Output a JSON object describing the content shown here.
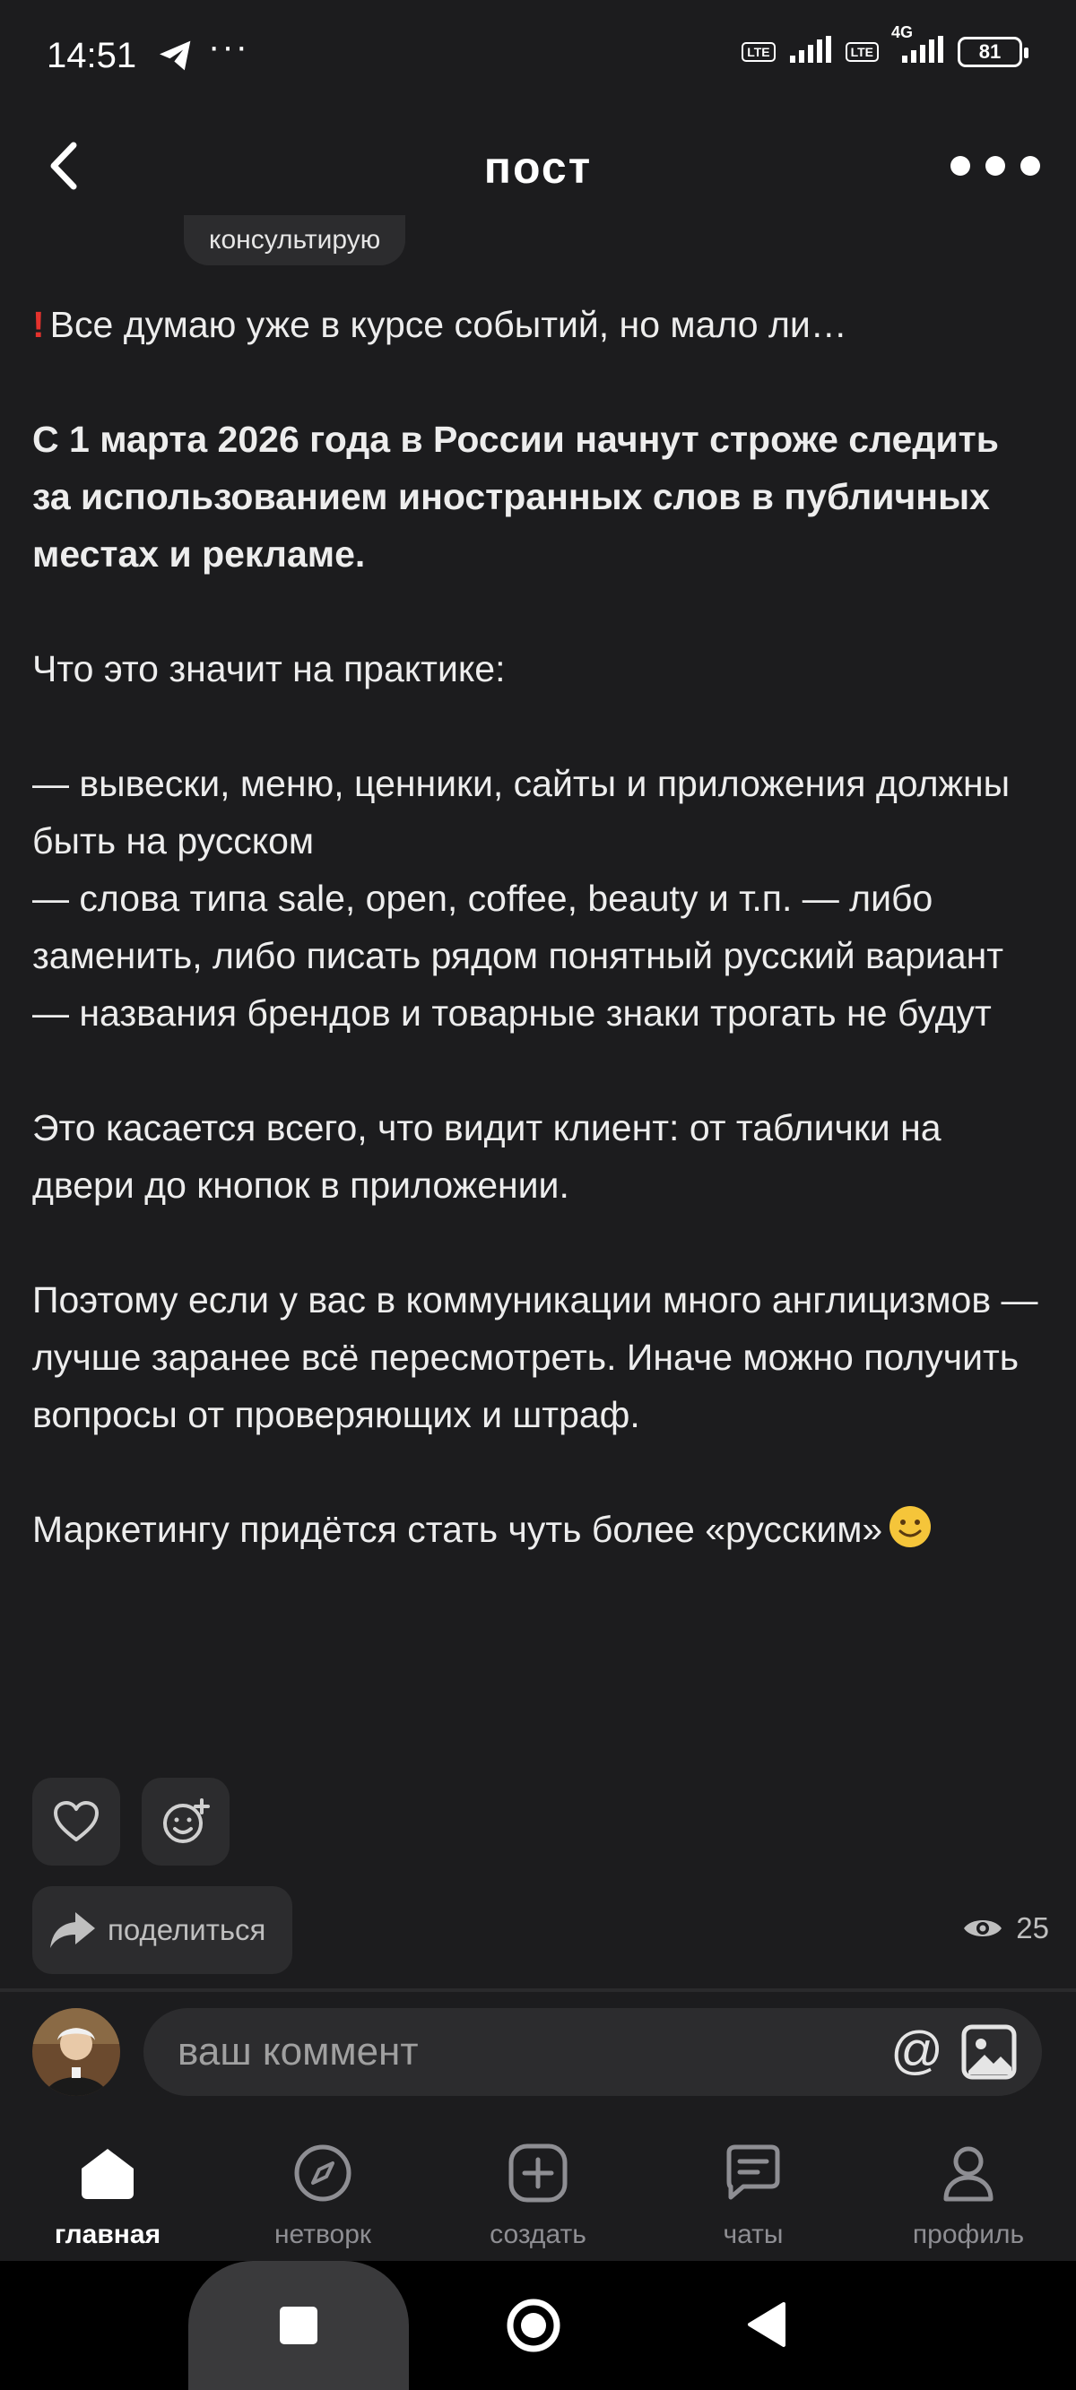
{
  "status_bar": {
    "time": "14:51",
    "more": "···",
    "volte1": "Vo LTE",
    "volte2": "Vo LTE",
    "network": "4G",
    "battery": "81"
  },
  "header": {
    "title": "пост"
  },
  "tag": {
    "label": "консультирую"
  },
  "post": {
    "intro": "Все думаю уже в курсе событий, но мало ли…",
    "headline": "С 1 марта 2026 года в России начнут строже следить за использованием иностранных слов в публичных местах и рекламе.",
    "p1": "Что это значит на практике:",
    "bullet1": "— вывески, меню, ценники, сайты и приложения должны быть на русском",
    "bullet2": "— слова типа sale, open, coffee, beauty и т.п. — либо заменить, либо писать рядом понятный русский вариант",
    "bullet3": "— названия брендов и товарные знаки трогать не будут",
    "p2": "Это касается всего, что видит клиент: от таблички на двери до кнопок в приложении.",
    "p3": "Поэтому если у вас в коммуникации много англицизмов — лучше заранее всё пересмотреть. Иначе можно получить вопросы от проверяющих и штраф.",
    "p4": "Маркетингу придётся стать чуть более «русским»"
  },
  "actions": {
    "share_label": "поделиться",
    "views_count": "25"
  },
  "comment": {
    "placeholder": "ваш коммент",
    "at_symbol": "@"
  },
  "nav": {
    "items": [
      {
        "label": "главная",
        "icon": "home-icon"
      },
      {
        "label": "нетворк",
        "icon": "compass-icon"
      },
      {
        "label": "создать",
        "icon": "plus-square-icon"
      },
      {
        "label": "чаты",
        "icon": "chat-icon"
      },
      {
        "label": "профиль",
        "icon": "user-icon"
      }
    ]
  },
  "colors": {
    "background": "#1c1c1e",
    "surface": "#2c2c2e",
    "accent_red": "#e5322d"
  }
}
